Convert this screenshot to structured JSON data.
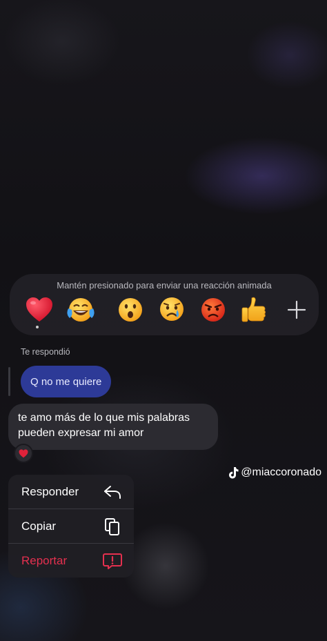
{
  "reaction_bar": {
    "hint": "Mantén presionado para enviar una reacción animada",
    "emojis": [
      "heart-emoji",
      "tears-of-joy-emoji",
      "surprised-emoji",
      "crying-emoji",
      "angry-emoji",
      "thumbs-up-emoji"
    ],
    "selected": "heart-emoji",
    "plus_icon": "plus-icon"
  },
  "conversation": {
    "reply_caption": "Te respondió",
    "replied_message": "Q no me quiere",
    "message_line1": "te amo más de lo que mis palabras",
    "message_line2": "pueden expresar mi amor",
    "reaction": "heart-emoji"
  },
  "watermark": {
    "handle": "@miaccoronado",
    "icon": "tiktok-icon"
  },
  "context_menu": {
    "reply_label": "Responder",
    "copy_label": "Copiar",
    "report_label": "Reportar",
    "report_color": "#e5304f"
  },
  "colors": {
    "reply_bubble": "#2d3a97",
    "message_bubble": "#2c2b31",
    "heart": "#e0223a"
  }
}
